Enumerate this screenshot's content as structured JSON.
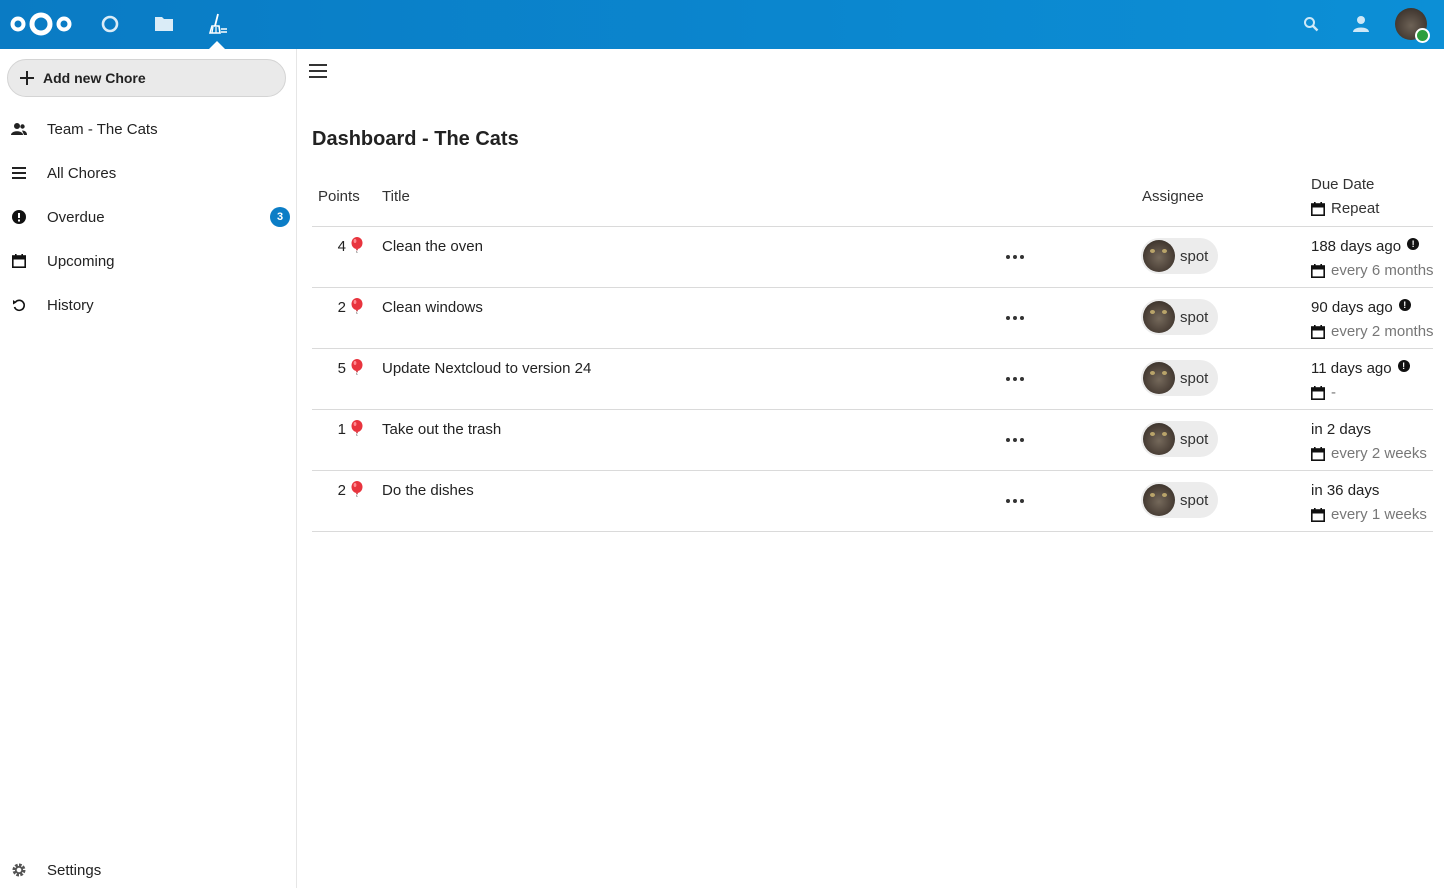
{
  "header": {
    "apps": [
      {
        "name": "dashboard-icon"
      },
      {
        "name": "files-icon"
      },
      {
        "name": "chores-icon",
        "active": true
      }
    ],
    "right_icons": [
      "search-icon",
      "contacts-icon"
    ],
    "accent": "#0b87cf",
    "status_color": "#2d9e3d"
  },
  "sidebar": {
    "add_label": "Add new Chore",
    "items": [
      {
        "label": "Team - The Cats",
        "icon": "team-icon"
      },
      {
        "label": "All Chores",
        "icon": "list-icon"
      },
      {
        "label": "Overdue",
        "icon": "alert-icon",
        "count": "3"
      },
      {
        "label": "Upcoming",
        "icon": "calendar-icon"
      },
      {
        "label": "History",
        "icon": "history-icon"
      }
    ],
    "settings_label": "Settings"
  },
  "main": {
    "title": "Dashboard - The Cats",
    "columns": {
      "points": "Points",
      "title": "Title",
      "assignee": "Assignee",
      "due_date": "Due Date",
      "repeat": "Repeat"
    },
    "rows": [
      {
        "points": "4",
        "title": "Clean the oven",
        "assignee": "spot",
        "due": "188 days ago",
        "overdue": true,
        "repeat": "every 6 months"
      },
      {
        "points": "2",
        "title": "Clean windows",
        "assignee": "spot",
        "due": "90 days ago",
        "overdue": true,
        "repeat": "every 2 months"
      },
      {
        "points": "5",
        "title": "Update Nextcloud to version 24",
        "assignee": "spot",
        "due": "11 days ago",
        "overdue": true,
        "repeat": "-"
      },
      {
        "points": "1",
        "title": "Take out the trash",
        "assignee": "spot",
        "due": "in 2 days",
        "overdue": false,
        "repeat": "every 2 weeks"
      },
      {
        "points": "2",
        "title": "Do the dishes",
        "assignee": "spot",
        "due": "in 36 days",
        "overdue": false,
        "repeat": "every 1 weeks"
      }
    ]
  }
}
